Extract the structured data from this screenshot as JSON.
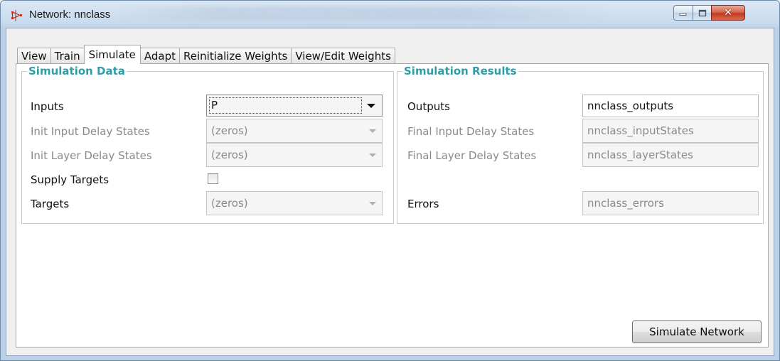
{
  "window": {
    "title": "Network: nnclass",
    "controls": {
      "minimize_icon": "minimize-icon",
      "maximize_icon": "maximize-icon",
      "close_icon": "close-icon"
    }
  },
  "tabs": [
    {
      "label": "View",
      "active": false
    },
    {
      "label": "Train",
      "active": false
    },
    {
      "label": "Simulate",
      "active": true
    },
    {
      "label": "Adapt",
      "active": false
    },
    {
      "label": "Reinitialize Weights",
      "active": false
    },
    {
      "label": "View/Edit Weights",
      "active": false
    }
  ],
  "simulation_data": {
    "title": "Simulation Data",
    "inputs": {
      "label": "Inputs",
      "value": "P"
    },
    "init_input_delay": {
      "label": "Init Input Delay States",
      "value": "(zeros)"
    },
    "init_layer_delay": {
      "label": "Init Layer Delay States",
      "value": "(zeros)"
    },
    "supply_targets": {
      "label": "Supply Targets",
      "checked": false
    },
    "targets": {
      "label": "Targets",
      "value": "(zeros)"
    }
  },
  "simulation_results": {
    "title": "Simulation Results",
    "outputs": {
      "label": "Outputs",
      "value": "nnclass_outputs"
    },
    "final_input_delay": {
      "label": "Final Input Delay States",
      "value": "nnclass_inputStates"
    },
    "final_layer_delay": {
      "label": "Final Layer Delay States",
      "value": "nnclass_layerStates"
    },
    "errors": {
      "label": "Errors",
      "value": "nnclass_errors"
    }
  },
  "buttons": {
    "simulate": "Simulate Network"
  },
  "colors": {
    "group_title": "#2e9ea8",
    "close_button": "#c23a22"
  }
}
